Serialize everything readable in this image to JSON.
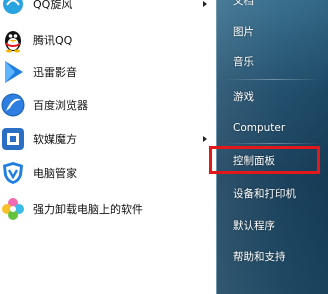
{
  "programs": [
    {
      "label": "QQ旋风",
      "icon": "qqxuanfeng-icon",
      "has_submenu": true
    },
    {
      "label": "腾讯QQ",
      "icon": "qq-penguin-icon",
      "has_submenu": false
    },
    {
      "label": "迅雷影音",
      "icon": "xunlei-player-icon",
      "has_submenu": false
    },
    {
      "label": "百度浏览器",
      "icon": "baidu-browser-icon",
      "has_submenu": false
    },
    {
      "label": "软媒魔方",
      "icon": "ruanmei-mofang-icon",
      "has_submenu": true
    },
    {
      "label": "电脑管家",
      "icon": "pc-manager-shield-icon",
      "has_submenu": false
    },
    {
      "label": "强力卸载电脑上的软件",
      "icon": "uninstall-flower-icon",
      "has_submenu": false
    }
  ],
  "right_menu": [
    {
      "label": "文档"
    },
    {
      "label": "图片"
    },
    {
      "label": "音乐"
    },
    {
      "label": "游戏"
    },
    {
      "label": "Computer"
    },
    {
      "label": "控制面板",
      "highlighted": true
    },
    {
      "label": "设备和打印机"
    },
    {
      "label": "默认程序"
    },
    {
      "label": "帮助和支持"
    }
  ],
  "colors": {
    "highlight_border": "#e3181a",
    "right_pane": "#1f4d6b"
  }
}
